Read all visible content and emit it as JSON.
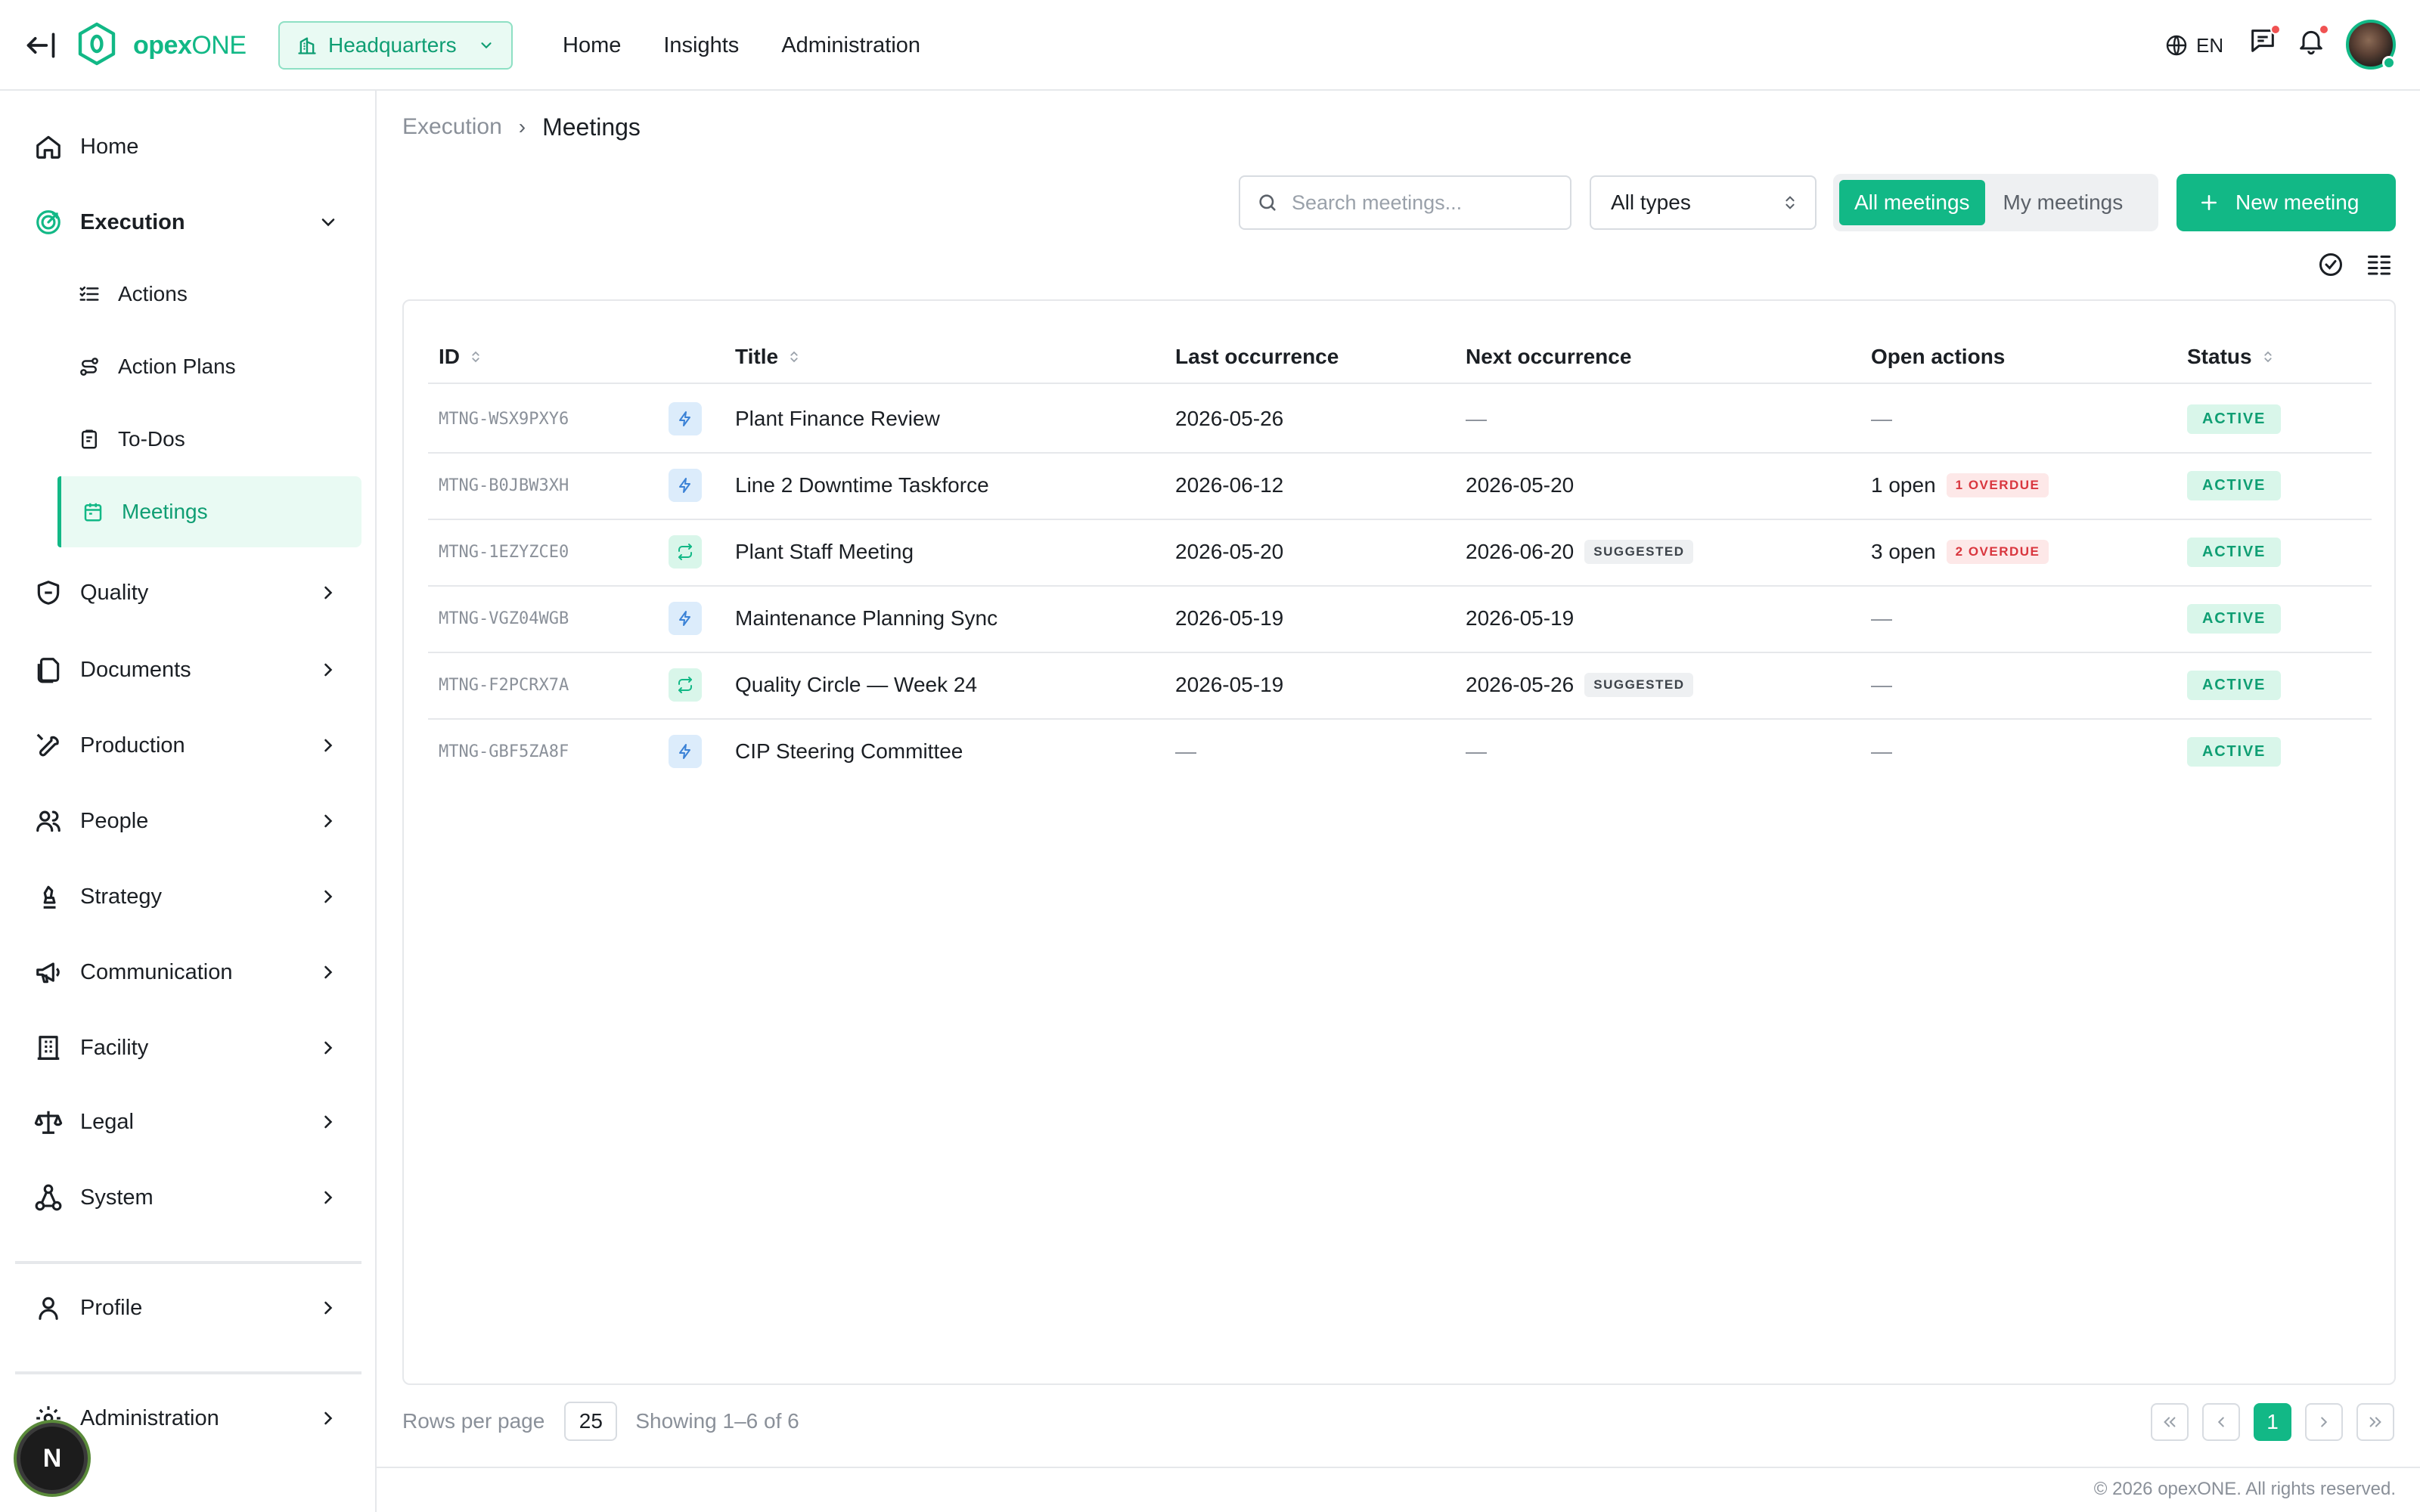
{
  "app": {
    "brand_bold": "opex",
    "brand_light": "ONE",
    "site": "Headquarters",
    "nav": [
      "Home",
      "Insights",
      "Administration"
    ],
    "lang": "EN",
    "accent": "#12b886",
    "icons": [
      "collapse-sidebar-icon",
      "hexagon-logo-icon",
      "building-icon",
      "globe-icon",
      "chat-icon",
      "bell-icon"
    ]
  },
  "sidebar": {
    "items": [
      {
        "label": "Home",
        "icon": "home-icon"
      },
      {
        "label": "Execution",
        "icon": "target-icon",
        "expanded": true
      },
      {
        "label": "Quality",
        "icon": "shield-icon"
      },
      {
        "label": "Documents",
        "icon": "documents-icon"
      },
      {
        "label": "Production",
        "icon": "wrench-icon"
      },
      {
        "label": "People",
        "icon": "people-icon"
      },
      {
        "label": "Strategy",
        "icon": "chess-icon"
      },
      {
        "label": "Communication",
        "icon": "megaphone-icon"
      },
      {
        "label": "Facility",
        "icon": "building-icon"
      },
      {
        "label": "Legal",
        "icon": "scale-icon"
      },
      {
        "label": "System",
        "icon": "network-icon"
      },
      {
        "label": "Profile",
        "icon": "user-icon"
      },
      {
        "label": "Administration",
        "icon": "gear-icon"
      }
    ],
    "sub": [
      {
        "label": "Actions",
        "icon": "list-check-icon"
      },
      {
        "label": "Action Plans",
        "icon": "route-icon"
      },
      {
        "label": "To-Dos",
        "icon": "clipboard-icon"
      },
      {
        "label": "Meetings",
        "icon": "calendar-icon",
        "active": true
      }
    ],
    "badge": "N"
  },
  "page": {
    "breadcrumb": [
      "Execution",
      "Meetings"
    ],
    "breadcrumb_sep": "›",
    "search_placeholder": "Search meetings...",
    "type_filter": "All types",
    "segments": [
      "All meetings",
      "My meetings"
    ],
    "new_button": "New meeting"
  },
  "table": {
    "headers": [
      "ID",
      "Title",
      "Last occurrence",
      "Next occurrence",
      "Open actions",
      "Status"
    ],
    "rows": [
      {
        "id": "MTNG-WSX9PXY6",
        "type": "bolt",
        "title": "Plant Finance Review",
        "last": "2026-05-26",
        "next": "—",
        "next_tag": "",
        "open": "—",
        "overdue": "",
        "status": "ACTIVE"
      },
      {
        "id": "MTNG-B0JBW3XH",
        "type": "bolt",
        "title": "Line 2 Downtime Taskforce",
        "last": "2026-06-12",
        "next": "2026-05-20",
        "next_tag": "",
        "open": "1 open",
        "overdue": "1 OVERDUE",
        "status": "ACTIVE"
      },
      {
        "id": "MTNG-1EZYZCE0",
        "type": "recur",
        "title": "Plant Staff Meeting",
        "last": "2026-05-20",
        "next": "2026-06-20",
        "next_tag": "SUGGESTED",
        "open": "3 open",
        "overdue": "2 OVERDUE",
        "status": "ACTIVE"
      },
      {
        "id": "MTNG-VGZ04WGB",
        "type": "bolt",
        "title": "Maintenance Planning Sync",
        "last": "2026-05-19",
        "next": "2026-05-19",
        "next_tag": "",
        "open": "—",
        "overdue": "",
        "status": "ACTIVE"
      },
      {
        "id": "MTNG-F2PCRX7A",
        "type": "recur",
        "title": "Quality Circle — Week 24",
        "last": "2026-05-19",
        "next": "2026-05-26",
        "next_tag": "SUGGESTED",
        "open": "—",
        "overdue": "",
        "status": "ACTIVE"
      },
      {
        "id": "MTNG-GBF5ZA8F",
        "type": "bolt",
        "title": "CIP Steering Committee",
        "last": "—",
        "next": "—",
        "next_tag": "",
        "open": "—",
        "overdue": "",
        "status": "ACTIVE"
      }
    ]
  },
  "pagination": {
    "rows_label": "Rows per page",
    "rows_value": "25",
    "showing": "Showing 1–6 of 6",
    "current_page": "1"
  },
  "footer": {
    "copyright": "© 2026 opexONE. All rights reserved."
  }
}
